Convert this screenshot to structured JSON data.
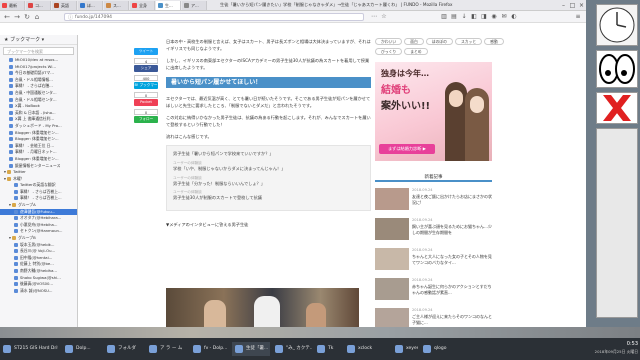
{
  "tabs": [
    "最新",
    "コ...",
    "英語",
    "ほ...",
    "ス...",
    "全身",
    "生...",
    "ア...",
    "X"
  ],
  "window_title": "生徒「暑いから短パン履きたい」学校「制服じゃなきゃダメ」→生徒「じゃあスカート履くわ」 | FUNDO - Mozilla Firefox",
  "url": "fundo.jp/147094",
  "sidebar": {
    "title": "ブックマーク",
    "search_placeholder": "ブックマークを検索",
    "items": [
      {
        "label": "MtO010/dev at msos...",
        "type": "bm",
        "indent": 1
      },
      {
        "label": "MtO017/projects Wi...",
        "type": "bm",
        "indent": 1
      },
      {
        "label": "今日の基礎用語(ITマ...",
        "type": "bm",
        "indent": 1
      },
      {
        "label": "台風・ドル相場情報...",
        "type": "bm",
        "indent": 1
      },
      {
        "label": "事縁！ - さらば右膳...",
        "type": "bm",
        "indent": 1
      },
      {
        "label": "台風・中国通販センタ...",
        "type": "bm",
        "indent": 1
      },
      {
        "label": "台風・ドル相場センタ...",
        "type": "bm",
        "indent": 1
      },
      {
        "label": "X翼 - NoBook",
        "type": "bm",
        "indent": 1
      },
      {
        "label": "英和 & 日本語 - Jisho...",
        "type": "bm",
        "indent": 1
      },
      {
        "label": "X翼 上 書庫通信社利...",
        "type": "bm",
        "indent": 1
      },
      {
        "label": "ダッシュボード - My Pro...",
        "type": "bm",
        "indent": 1
      },
      {
        "label": "Blogger: 体重増加セン...",
        "type": "bm",
        "indent": 1
      },
      {
        "label": "Blogger: 体重増加セン...",
        "type": "bm",
        "indent": 1
      },
      {
        "label": "事縁！ - 芸能王位 日...",
        "type": "bm",
        "indent": 1
      },
      {
        "label": "事縁！ - 月曜日ネット...",
        "type": "bm",
        "indent": 1
      },
      {
        "label": "Blogger: 体重増加セン...",
        "type": "bm",
        "indent": 1
      },
      {
        "label": "飯屋情報センターニュース",
        "type": "bm",
        "indent": 1
      },
      {
        "label": "Twitter",
        "type": "folder",
        "indent": 0
      },
      {
        "label": "木曜！",
        "type": "folder",
        "indent": 0
      },
      {
        "label": "Twitterの英語な翻訳",
        "type": "bm",
        "indent": 2
      },
      {
        "label": "事縁！ - さらば百樹上...",
        "type": "bm",
        "indent": 2
      },
      {
        "label": "事縁！ - さらば百樹上...",
        "type": "bm",
        "indent": 2
      },
      {
        "label": "グループA",
        "type": "folder",
        "indent": 1
      },
      {
        "label": "遊澤健吾(@Fukuu...",
        "type": "bm",
        "indent": 2,
        "selected": true
      },
      {
        "label": "オオタナ(@Hebihara...",
        "type": "bm",
        "indent": 2
      },
      {
        "label": "小悪党舟(@Hebiha...",
        "type": "bm",
        "indent": 2
      },
      {
        "label": "セトクン(@Hanmoun...",
        "type": "bm",
        "indent": 2
      },
      {
        "label": "グループB",
        "type": "folder",
        "indent": 1
      },
      {
        "label": "坂本玉男(@hebik...",
        "type": "bm",
        "indent": 2
      },
      {
        "label": "長谷川(@ Voji-Ou...",
        "type": "bm",
        "indent": 2
      },
      {
        "label": "田中隆(@hentai...",
        "type": "bm",
        "indent": 2
      },
      {
        "label": "佐藤上 特別(@be...",
        "type": "bm",
        "indent": 2
      },
      {
        "label": "南野大輔(@hebiha...",
        "type": "bm",
        "indent": 2
      },
      {
        "label": "Shoko Sugiwa(@shi...",
        "type": "bm",
        "indent": 2
      },
      {
        "label": "後藤真(@VOS00...",
        "type": "bm",
        "indent": 2
      },
      {
        "label": "清水 誠(@NOSU...",
        "type": "bm",
        "indent": 2
      }
    ]
  },
  "share": {
    "tweet": "ツイート",
    "fb_count": "4",
    "share": "シェア",
    "hatena_count": "400",
    "hatena": "B! ブックマーク",
    "pocket_count": "0",
    "pocket": "Pocket",
    "g_count": "0",
    "feedly": "フォロー"
  },
  "article": {
    "p1": "日本の中・高校生の制服と言えば、女子はスカート、男子は長ズボンと相場は大体決まっていますが、それはイギリスでも同じなようです。",
    "p2": "しかし、イギリスの南東部エセクターのISCAアカデミーの男子生徒30人が抗議の為スカートを着用して授業に出席したようです。",
    "h2": "暑いから短パン履かせてほしい！",
    "p3": "エセクターでは、最近気温が高く、とても暑い日が続いたそうです。そこである男子生徒が短パンを履かせてほしいと先生に要求したところ、「制服でないとダメだ」と言われたそうです。",
    "p4": "この対応に納得いかなかった男子生徒は、抗議の為ある行動を起こします。それが、みんなでスカートを履いて登校するという行動でした！",
    "p5": "流れはこんな感じです。",
    "quotes": [
      "男子生徒「暑いから短パンで学校来ていいですか？」",
      "学校「いや、制服じゃないからダメに決まってんじゃん！」",
      "男子生徒「分かった！制服ならいいんでしょ？」",
      "男子生徒30人が制服のスカートで登校して抗議"
    ],
    "qtags": [
      "ユーザーの体験談",
      "ユーザーの体験談",
      "ユーザーの体験談"
    ],
    "media_head": "▼メディアのインタビューに答える男子生徒"
  },
  "right": {
    "pills": [
      "かわいい",
      "面白",
      "ほのぼの",
      "スカッと",
      "感動",
      "びっくり",
      "まとめ"
    ],
    "ad": {
      "l1": "独身は今年…",
      "l2": "結婚も",
      "l3": "案外いい!!",
      "btn": "まずは結婚力診断 ▶"
    },
    "news_head": "新着記事",
    "news": [
      {
        "date": "2018.09.24",
        "title": "友達と夜ご飯に出かけたらお店にまさかの状況に!"
      },
      {
        "date": "2018.09.24",
        "title": "飼い主が喜ぶ顔を見るためにお猫ちゃん…少しの期間が生存期間を"
      },
      {
        "date": "2018.09.24",
        "title": "ちゃんと大人になった女の子とその人物を見てワンコのバカなタイ..."
      },
      {
        "date": "2018.09.24",
        "title": "赤ちゃん誕生に何らかのアクションとすだちゃんの感動話が素直..."
      },
      {
        "date": "2018.09.24",
        "title": "ご主人様が迎えに来たらそのワンコのなんと子猫に..."
      }
    ]
  },
  "taskbar": {
    "items": [
      "ST215 GIS Hard Drive",
      "Dolp...",
      "フォルダ",
      "ア ラ ー ム",
      "fv - Dolp...",
      "生徒「暑...",
      "\"み_ カクテ...",
      "Tk",
      "xclock",
      "xeyes",
      "qlogo"
    ],
    "time": "0:53",
    "date": "2018年09月25日 火曜日"
  },
  "colors": {
    "accent": "#4a90c8",
    "selected": "#3d7ad8",
    "tweet": "#1da1f2",
    "fb": "#3b5998",
    "hatena": "#00a4de",
    "pocket": "#ef4056",
    "feedly": "#2bb24c",
    "ad_btn": "#e8409a"
  }
}
